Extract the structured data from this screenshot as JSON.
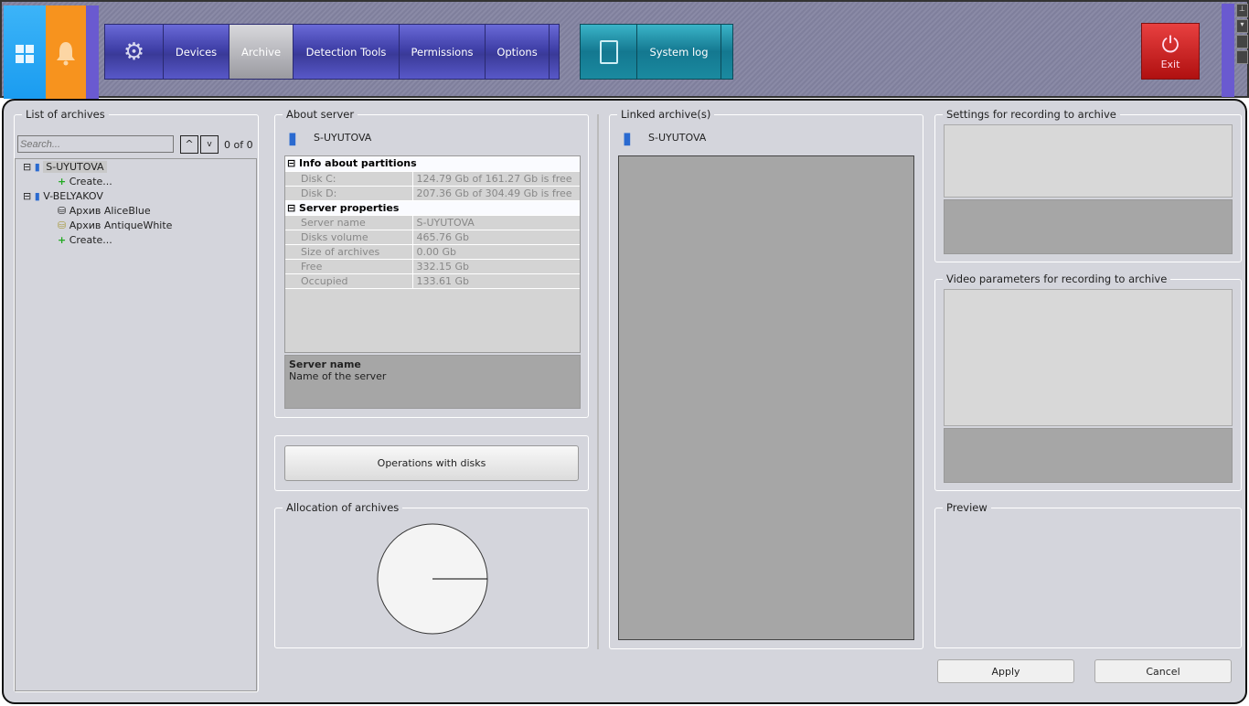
{
  "nav": {
    "items": [
      "Devices",
      "Archive",
      "Detection Tools",
      "Permissions",
      "Options"
    ],
    "active": "Archive",
    "system_log": "System log",
    "exit": "Exit"
  },
  "list": {
    "title": "List of archives",
    "search_placeholder": "Search...",
    "count": "0 of 0",
    "tree": [
      {
        "label": "S-UYUTOVA",
        "children": [
          "Create..."
        ]
      },
      {
        "label": "V-BELYAKOV",
        "children": [
          "Архив AliceBlue",
          "Архив AntiqueWhite",
          "Create..."
        ]
      }
    ]
  },
  "about": {
    "title": "About server",
    "server": "S-UYUTOVA",
    "sec1": "Info about partitions",
    "partitions": [
      {
        "k": "Disk C:",
        "v": "124.79 Gb of 161.27 Gb is free"
      },
      {
        "k": "Disk D:",
        "v": "207.36 Gb of 304.49 Gb is free"
      }
    ],
    "sec2": "Server properties",
    "props": [
      {
        "k": "Server name",
        "v": "S-UYUTOVA"
      },
      {
        "k": "Disks volume",
        "v": "465.76 Gb"
      },
      {
        "k": "Size of archives",
        "v": "0.00 Gb"
      },
      {
        "k": "Free",
        "v": "332.15 Gb"
      },
      {
        "k": "Occupied",
        "v": "133.61 Gb"
      }
    ],
    "desc_title": "Server name",
    "desc_text": "Name of the server"
  },
  "ops_button": "Operations with disks",
  "allocation": {
    "title": "Allocation of archives"
  },
  "linked": {
    "title": "Linked archive(s)",
    "server": "S-UYUTOVA"
  },
  "settings_title": "Settings for recording to archive",
  "video_title": "Video parameters for recording to archive",
  "preview_title": "Preview",
  "apply": "Apply",
  "cancel": "Cancel"
}
